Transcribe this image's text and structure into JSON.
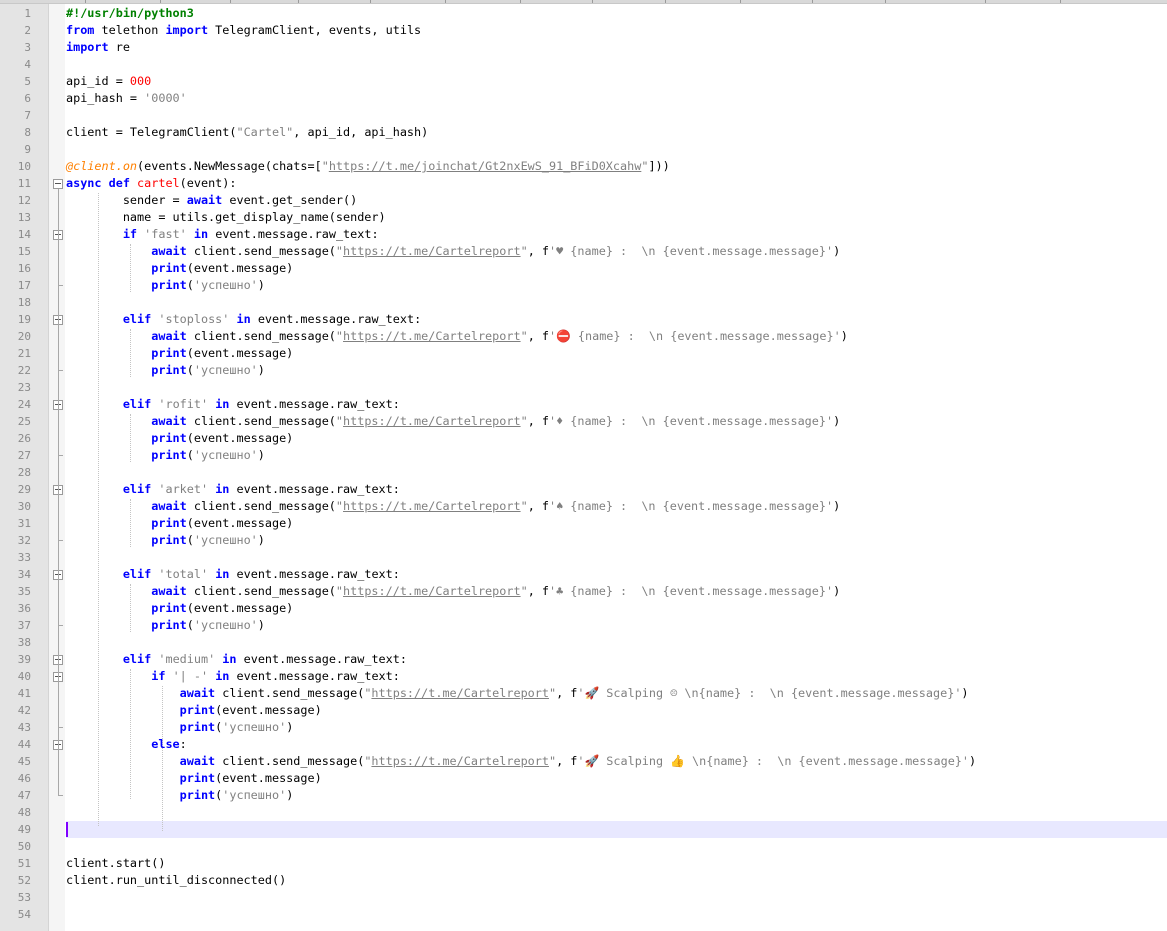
{
  "editor": {
    "line_numbers": [
      "1",
      "2",
      "3",
      "4",
      "5",
      "6",
      "7",
      "8",
      "9",
      "10",
      "11",
      "12",
      "13",
      "14",
      "15",
      "16",
      "17",
      "18",
      "19",
      "20",
      "21",
      "22",
      "23",
      "24",
      "25",
      "26",
      "27",
      "28",
      "29",
      "30",
      "31",
      "32",
      "33",
      "34",
      "35",
      "36",
      "37",
      "38",
      "39",
      "40",
      "41",
      "42",
      "43",
      "44",
      "45",
      "46",
      "47",
      "48",
      "49",
      "50",
      "51",
      "52",
      "53",
      "54"
    ],
    "current_line": "49",
    "lines": [
      [
        {
          "t": "#!/usr/bin/python3",
          "c": "c"
        }
      ],
      [
        {
          "t": "from",
          "c": "k"
        },
        {
          "t": " telethon "
        },
        {
          "t": "import",
          "c": "k"
        },
        {
          "t": " TelegramClient, events, utils"
        }
      ],
      [
        {
          "t": "import",
          "c": "k"
        },
        {
          "t": " re"
        }
      ],
      [],
      [
        {
          "t": "api_id = "
        },
        {
          "t": "000",
          "c": "n"
        }
      ],
      [
        {
          "t": "api_hash = "
        },
        {
          "t": "'0000'",
          "c": "s"
        }
      ],
      [],
      [
        {
          "t": "client = TelegramClient("
        },
        {
          "t": "\"Cartel\"",
          "c": "s"
        },
        {
          "t": ", api_id, api_hash)"
        }
      ],
      [],
      [
        {
          "t": "@client.on",
          "c": "d"
        },
        {
          "t": "(events.NewMessage(chats=["
        },
        {
          "t": "\"",
          "c": "s"
        },
        {
          "t": "https://t.me/joinchat/Gt2nxEwS_91_BFiD0Xcahw",
          "c": "u"
        },
        {
          "t": "\"",
          "c": "s"
        },
        {
          "t": "]))"
        }
      ],
      [
        {
          "t": "async",
          "c": "k"
        },
        {
          "t": " "
        },
        {
          "t": "def",
          "c": "k"
        },
        {
          "t": " "
        },
        {
          "t": "cartel",
          "c": "f"
        },
        {
          "t": "(event):"
        }
      ],
      [
        {
          "t": "        sender = "
        },
        {
          "t": "await",
          "c": "k"
        },
        {
          "t": " event.get_sender()"
        }
      ],
      [
        {
          "t": "        name = utils.get_display_name(sender)"
        }
      ],
      [
        {
          "t": "        "
        },
        {
          "t": "if",
          "c": "k"
        },
        {
          "t": " "
        },
        {
          "t": "'fast'",
          "c": "s"
        },
        {
          "t": " "
        },
        {
          "t": "in",
          "c": "k"
        },
        {
          "t": " event.message.raw_text:"
        }
      ],
      [
        {
          "t": "            "
        },
        {
          "t": "await",
          "c": "k"
        },
        {
          "t": " client.send_message("
        },
        {
          "t": "\"",
          "c": "s"
        },
        {
          "t": "https://t.me/Cartelreport",
          "c": "u"
        },
        {
          "t": "\"",
          "c": "s"
        },
        {
          "t": ", f"
        },
        {
          "t": "'♥ {name} :  \\n {event.message.message}'",
          "c": "s"
        },
        {
          "t": ")"
        }
      ],
      [
        {
          "t": "            "
        },
        {
          "t": "print",
          "c": "k"
        },
        {
          "t": "(event.message)"
        }
      ],
      [
        {
          "t": "            "
        },
        {
          "t": "print",
          "c": "k"
        },
        {
          "t": "("
        },
        {
          "t": "'успешно'",
          "c": "s"
        },
        {
          "t": ")"
        }
      ],
      [],
      [
        {
          "t": "        "
        },
        {
          "t": "elif",
          "c": "k"
        },
        {
          "t": " "
        },
        {
          "t": "'stoploss'",
          "c": "s"
        },
        {
          "t": " "
        },
        {
          "t": "in",
          "c": "k"
        },
        {
          "t": " event.message.raw_text:"
        }
      ],
      [
        {
          "t": "            "
        },
        {
          "t": "await",
          "c": "k"
        },
        {
          "t": " client.send_message("
        },
        {
          "t": "\"",
          "c": "s"
        },
        {
          "t": "https://t.me/Cartelreport",
          "c": "u"
        },
        {
          "t": "\"",
          "c": "s"
        },
        {
          "t": ", f"
        },
        {
          "t": "'⛔ {name} :  \\n {event.message.message}'",
          "c": "s"
        },
        {
          "t": ")"
        }
      ],
      [
        {
          "t": "            "
        },
        {
          "t": "print",
          "c": "k"
        },
        {
          "t": "(event.message)"
        }
      ],
      [
        {
          "t": "            "
        },
        {
          "t": "print",
          "c": "k"
        },
        {
          "t": "("
        },
        {
          "t": "'успешно'",
          "c": "s"
        },
        {
          "t": ")"
        }
      ],
      [],
      [
        {
          "t": "        "
        },
        {
          "t": "elif",
          "c": "k"
        },
        {
          "t": " "
        },
        {
          "t": "'rofit'",
          "c": "s"
        },
        {
          "t": " "
        },
        {
          "t": "in",
          "c": "k"
        },
        {
          "t": " event.message.raw_text:"
        }
      ],
      [
        {
          "t": "            "
        },
        {
          "t": "await",
          "c": "k"
        },
        {
          "t": " client.send_message("
        },
        {
          "t": "\"",
          "c": "s"
        },
        {
          "t": "https://t.me/Cartelreport",
          "c": "u"
        },
        {
          "t": "\"",
          "c": "s"
        },
        {
          "t": ", f"
        },
        {
          "t": "'♦ {name} :  \\n {event.message.message}'",
          "c": "s"
        },
        {
          "t": ")"
        }
      ],
      [
        {
          "t": "            "
        },
        {
          "t": "print",
          "c": "k"
        },
        {
          "t": "(event.message)"
        }
      ],
      [
        {
          "t": "            "
        },
        {
          "t": "print",
          "c": "k"
        },
        {
          "t": "("
        },
        {
          "t": "'успешно'",
          "c": "s"
        },
        {
          "t": ")"
        }
      ],
      [],
      [
        {
          "t": "        "
        },
        {
          "t": "elif",
          "c": "k"
        },
        {
          "t": " "
        },
        {
          "t": "'arket'",
          "c": "s"
        },
        {
          "t": " "
        },
        {
          "t": "in",
          "c": "k"
        },
        {
          "t": " event.message.raw_text:"
        }
      ],
      [
        {
          "t": "            "
        },
        {
          "t": "await",
          "c": "k"
        },
        {
          "t": " client.send_message("
        },
        {
          "t": "\"",
          "c": "s"
        },
        {
          "t": "https://t.me/Cartelreport",
          "c": "u"
        },
        {
          "t": "\"",
          "c": "s"
        },
        {
          "t": ", f"
        },
        {
          "t": "'♠ {name} :  \\n {event.message.message}'",
          "c": "s"
        },
        {
          "t": ")"
        }
      ],
      [
        {
          "t": "            "
        },
        {
          "t": "print",
          "c": "k"
        },
        {
          "t": "(event.message)"
        }
      ],
      [
        {
          "t": "            "
        },
        {
          "t": "print",
          "c": "k"
        },
        {
          "t": "("
        },
        {
          "t": "'успешно'",
          "c": "s"
        },
        {
          "t": ")"
        }
      ],
      [],
      [
        {
          "t": "        "
        },
        {
          "t": "elif",
          "c": "k"
        },
        {
          "t": " "
        },
        {
          "t": "'total'",
          "c": "s"
        },
        {
          "t": " "
        },
        {
          "t": "in",
          "c": "k"
        },
        {
          "t": " event.message.raw_text:"
        }
      ],
      [
        {
          "t": "            "
        },
        {
          "t": "await",
          "c": "k"
        },
        {
          "t": " client.send_message("
        },
        {
          "t": "\"",
          "c": "s"
        },
        {
          "t": "https://t.me/Cartelreport",
          "c": "u"
        },
        {
          "t": "\"",
          "c": "s"
        },
        {
          "t": ", f"
        },
        {
          "t": "'♣ {name} :  \\n {event.message.message}'",
          "c": "s"
        },
        {
          "t": ")"
        }
      ],
      [
        {
          "t": "            "
        },
        {
          "t": "print",
          "c": "k"
        },
        {
          "t": "(event.message)"
        }
      ],
      [
        {
          "t": "            "
        },
        {
          "t": "print",
          "c": "k"
        },
        {
          "t": "("
        },
        {
          "t": "'успешно'",
          "c": "s"
        },
        {
          "t": ")"
        }
      ],
      [],
      [
        {
          "t": "        "
        },
        {
          "t": "elif",
          "c": "k"
        },
        {
          "t": " "
        },
        {
          "t": "'medium'",
          "c": "s"
        },
        {
          "t": " "
        },
        {
          "t": "in",
          "c": "k"
        },
        {
          "t": " event.message.raw_text:"
        }
      ],
      [
        {
          "t": "            "
        },
        {
          "t": "if",
          "c": "k"
        },
        {
          "t": " "
        },
        {
          "t": "'| -'",
          "c": "s"
        },
        {
          "t": " "
        },
        {
          "t": "in",
          "c": "k"
        },
        {
          "t": " event.message.raw_text:"
        }
      ],
      [
        {
          "t": "                "
        },
        {
          "t": "await",
          "c": "k"
        },
        {
          "t": " client.send_message("
        },
        {
          "t": "\"",
          "c": "s"
        },
        {
          "t": "https://t.me/Cartelreport",
          "c": "u"
        },
        {
          "t": "\"",
          "c": "s"
        },
        {
          "t": ", f"
        },
        {
          "t": "'🚀 Scalping ☹ \\n{name} :  \\n {event.message.message}'",
          "c": "s"
        },
        {
          "t": ")"
        }
      ],
      [
        {
          "t": "                "
        },
        {
          "t": "print",
          "c": "k"
        },
        {
          "t": "(event.message)"
        }
      ],
      [
        {
          "t": "                "
        },
        {
          "t": "print",
          "c": "k"
        },
        {
          "t": "("
        },
        {
          "t": "'успешно'",
          "c": "s"
        },
        {
          "t": ")"
        }
      ],
      [
        {
          "t": "            "
        },
        {
          "t": "else",
          "c": "k"
        },
        {
          "t": ":"
        }
      ],
      [
        {
          "t": "                "
        },
        {
          "t": "await",
          "c": "k"
        },
        {
          "t": " client.send_message("
        },
        {
          "t": "\"",
          "c": "s"
        },
        {
          "t": "https://t.me/Cartelreport",
          "c": "u"
        },
        {
          "t": "\"",
          "c": "s"
        },
        {
          "t": ", f"
        },
        {
          "t": "'🚀 Scalping 👍 \\n{name} :  \\n {event.message.message}'",
          "c": "s"
        },
        {
          "t": ")"
        }
      ],
      [
        {
          "t": "                "
        },
        {
          "t": "print",
          "c": "k"
        },
        {
          "t": "(event.message)"
        }
      ],
      [
        {
          "t": "                "
        },
        {
          "t": "print",
          "c": "k"
        },
        {
          "t": "("
        },
        {
          "t": "'успешно'",
          "c": "s"
        },
        {
          "t": ")"
        }
      ],
      [],
      [],
      [],
      [
        {
          "t": "client.start()"
        }
      ],
      [
        {
          "t": "client.run_until_disconnected()"
        }
      ],
      [],
      []
    ]
  }
}
